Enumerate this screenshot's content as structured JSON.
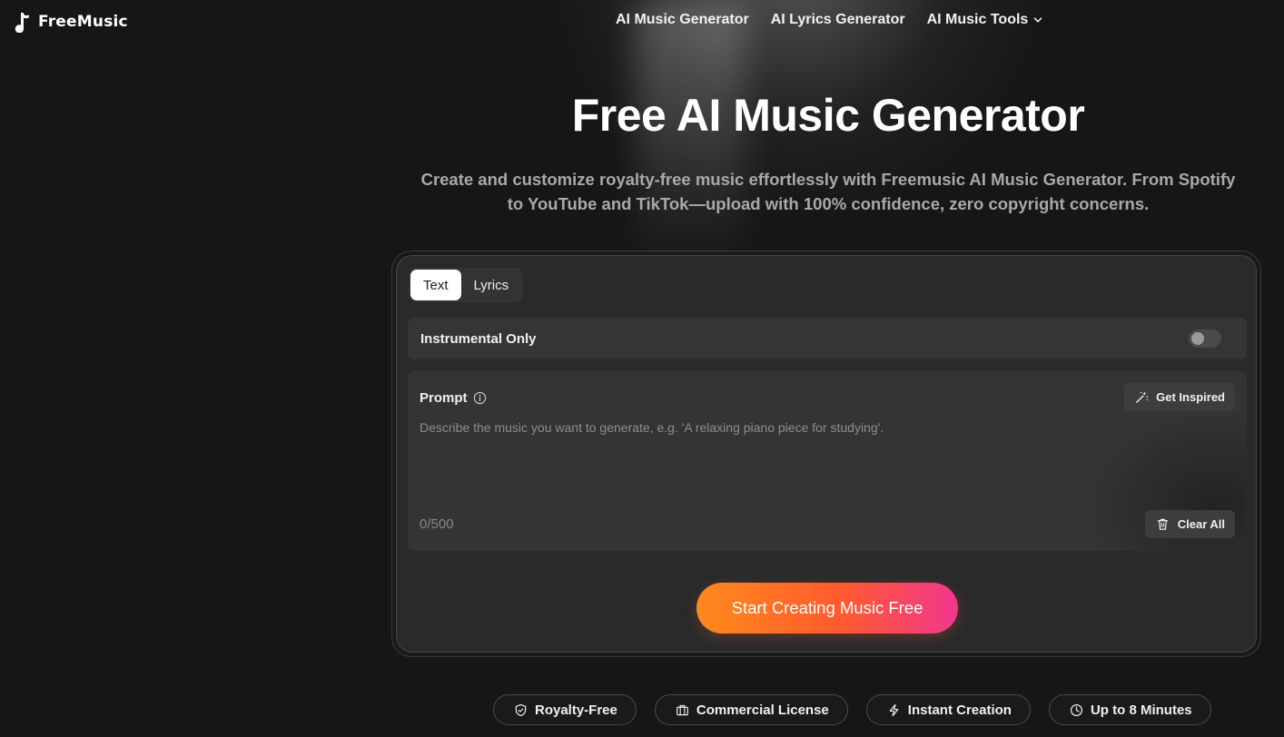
{
  "brand": {
    "name": "FreeMusic"
  },
  "nav": {
    "items": [
      {
        "label": "AI Music Generator"
      },
      {
        "label": "AI Lyrics Generator"
      },
      {
        "label": "AI Music Tools"
      }
    ]
  },
  "hero": {
    "title": "Free AI Music Generator",
    "subtitle": "Create and customize royalty-free music effortlessly with Freemusic AI Music Generator. From Spotify to YouTube and TikTok—upload with 100% confidence, zero copyright concerns."
  },
  "generator": {
    "tabs": [
      {
        "label": "Text",
        "active": true
      },
      {
        "label": "Lyrics",
        "active": false
      }
    ],
    "instrumental": {
      "label": "Instrumental Only",
      "enabled": false
    },
    "prompt": {
      "label": "Prompt",
      "placeholder": "Describe the music you want to generate, e.g. 'A relaxing piano piece for studying'.",
      "value": "",
      "counter": "0/500",
      "inspire_label": "Get Inspired",
      "clear_label": "Clear All"
    },
    "cta_label": "Start Creating Music Free"
  },
  "features": [
    {
      "label": "Royalty-Free",
      "icon": "shield-icon"
    },
    {
      "label": "Commercial License",
      "icon": "briefcase-icon"
    },
    {
      "label": "Instant Creation",
      "icon": "lightning-icon"
    },
    {
      "label": "Up to 8 Minutes",
      "icon": "clock-icon"
    }
  ],
  "colors": {
    "background": "#161616",
    "card": "#2a2a2a",
    "cta_gradient_start": "#ff8a1c",
    "cta_gradient_end": "#f0378f"
  }
}
